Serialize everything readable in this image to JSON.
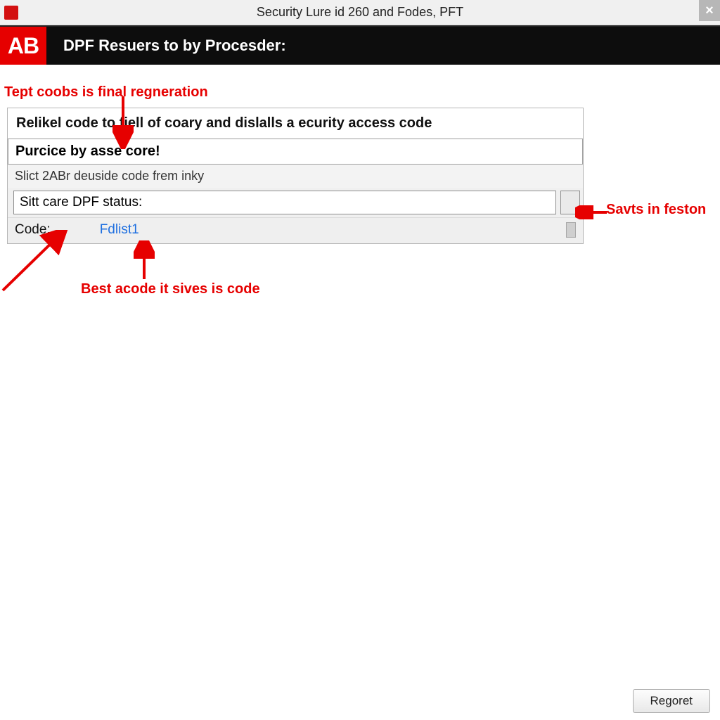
{
  "window": {
    "title": "Security Lure id 260 and Fodes, PFT",
    "close_glyph": "×"
  },
  "header": {
    "brand": "AB",
    "title": "DPF Resuers to by Procesder:"
  },
  "annotations": {
    "top_note": "Tept coobs is final regneration",
    "right_note": "Savts in feston",
    "bottom_note": "Best acode it sives is code"
  },
  "panel": {
    "heading": "Relikel code to   fiell of coary and dislalls a ecurity access code",
    "sub": "Purcice by asse core!",
    "slict": "Slict  2ABr deuside code frem inky",
    "status_value": "Sitt care DPF status:",
    "go_button_label": "",
    "code_label": "Code:",
    "code_link": "Fdlist1"
  },
  "footer": {
    "regoret": "Regoret"
  },
  "colors": {
    "accent_red": "#e60000",
    "header_black": "#0d0d0d",
    "link_blue": "#1e6fe0"
  }
}
